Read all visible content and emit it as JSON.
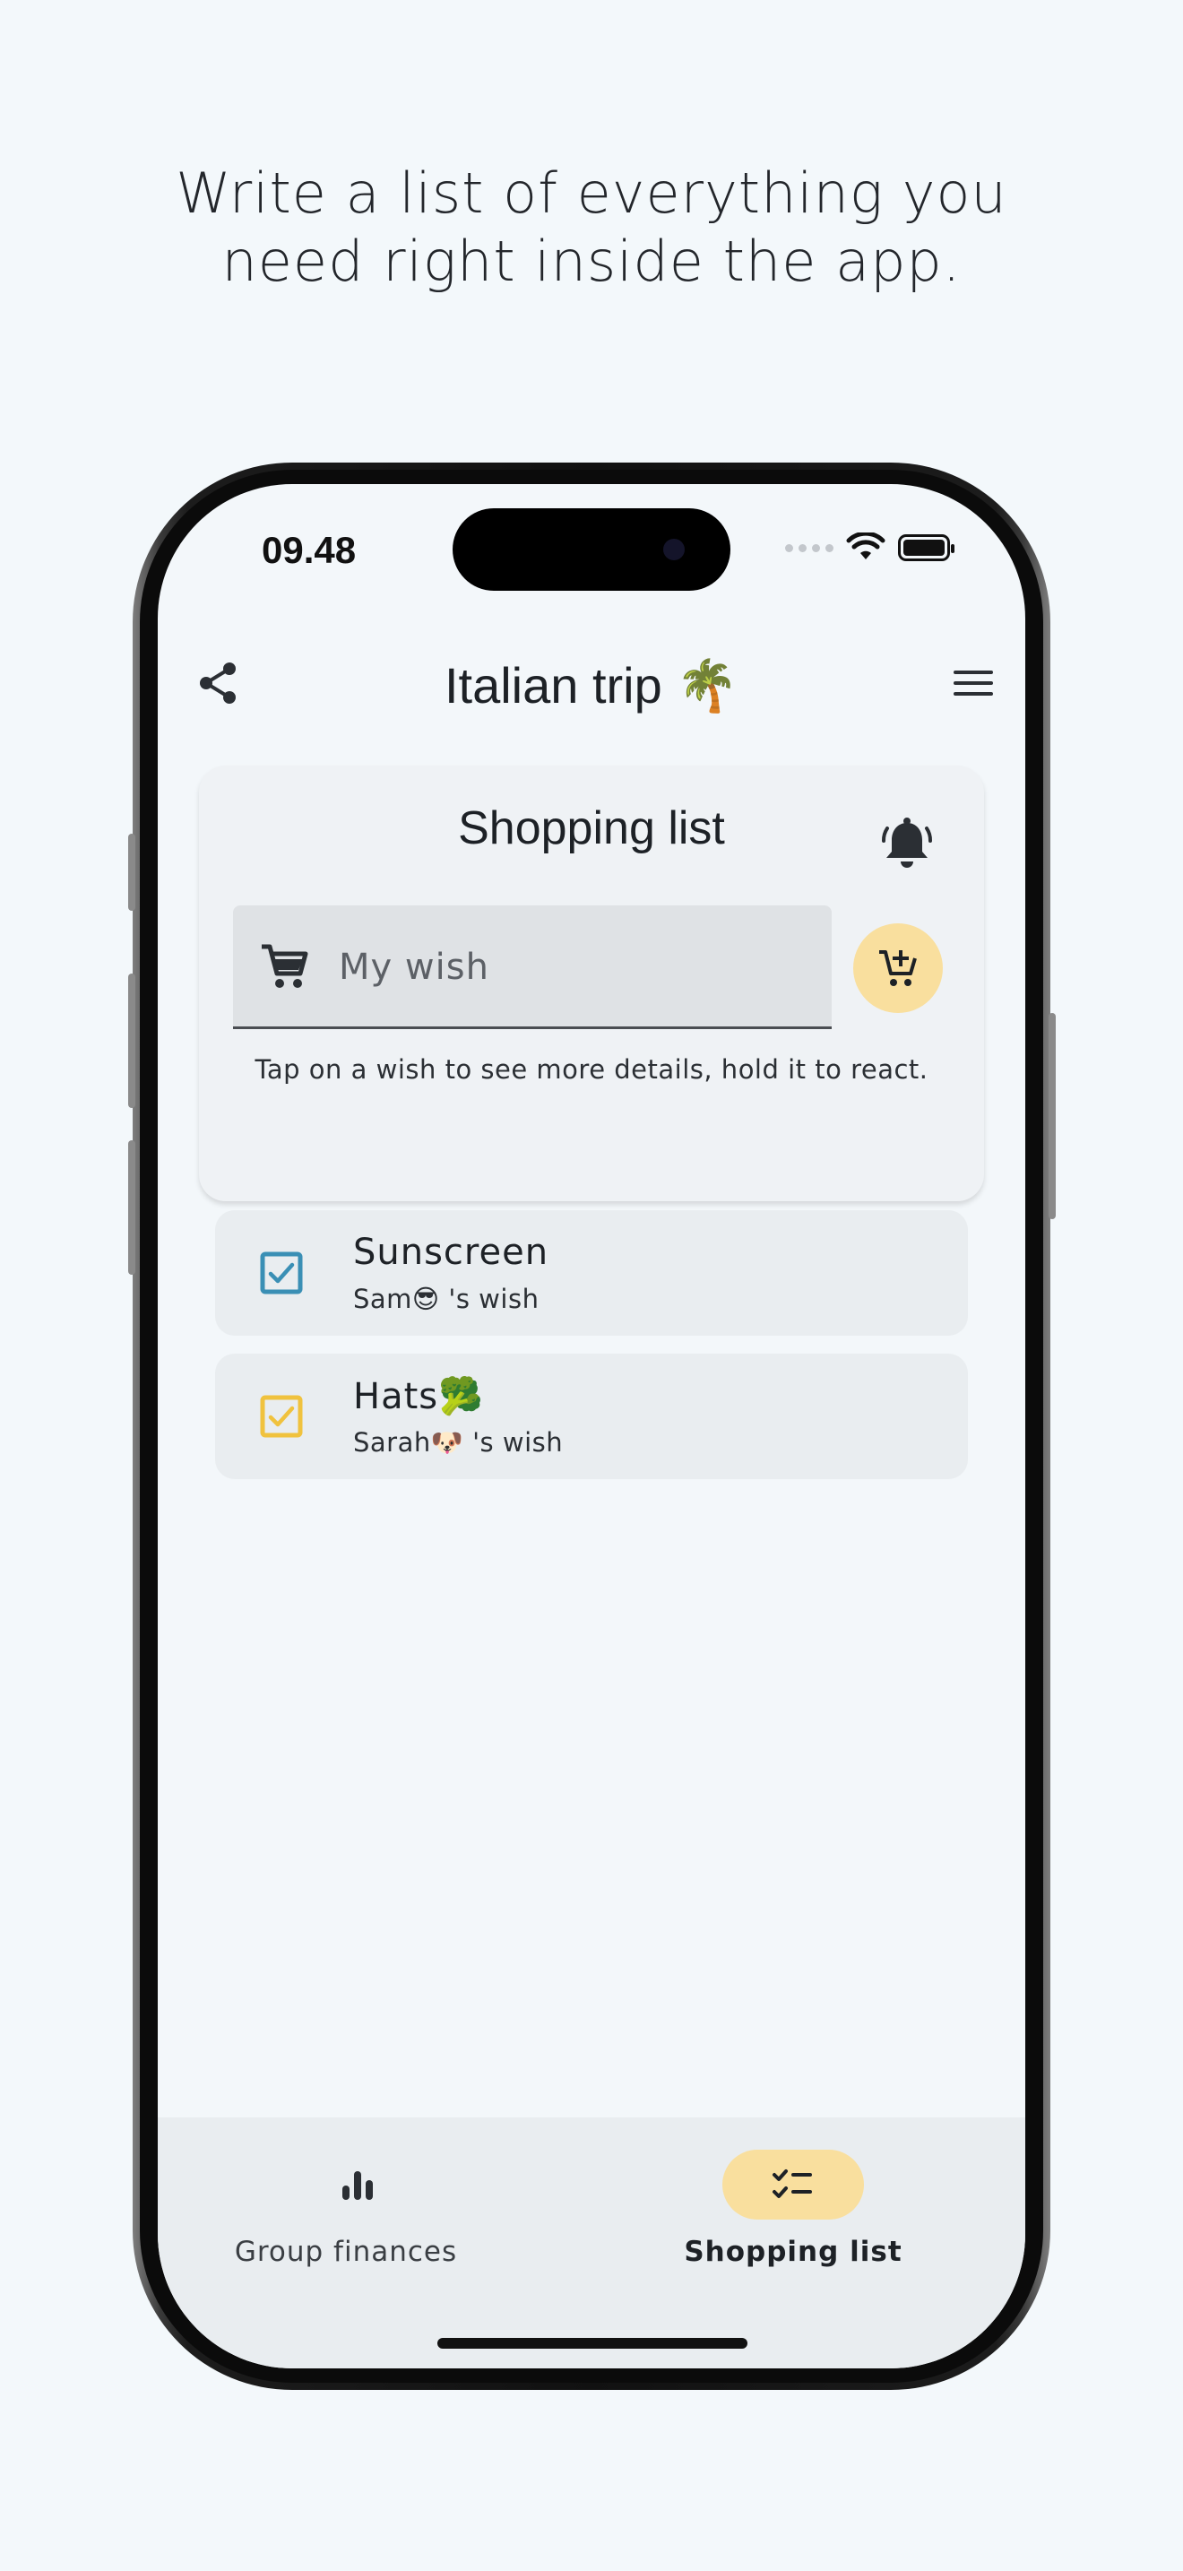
{
  "headline": {
    "line1": "Write a list of everything you",
    "line2": "need right inside the app."
  },
  "status_bar": {
    "time": "09.48",
    "icons": [
      "cellular-dots-icon",
      "wifi-icon",
      "battery-icon"
    ]
  },
  "header": {
    "title": "Italian trip 🌴",
    "share_icon": "share-icon",
    "menu_icon": "hamburger-menu-icon"
  },
  "shopping_card": {
    "title": "Shopping list",
    "bell_icon": "bell-ring-icon",
    "wish_input": {
      "placeholder": "My wish",
      "value": "",
      "icon": "cart-icon"
    },
    "add_button_icon": "cart-plus-icon",
    "hint": "Tap on a wish to see more details, hold it to react."
  },
  "wishes": [
    {
      "name": "Sunscreen",
      "owner": "Sam😎 's wish",
      "checked": true,
      "color": "#3a8fb5"
    },
    {
      "name": "Hats🥦",
      "owner": "Sarah🐶 's wish",
      "checked": true,
      "color": "#f0c23e"
    }
  ],
  "bottom_nav": {
    "items": [
      {
        "label": "Group finances",
        "icon": "bar-chart-icon",
        "active": false
      },
      {
        "label": "Shopping list",
        "icon": "checklist-icon",
        "active": true
      }
    ],
    "active_color": "#f9df9e"
  }
}
